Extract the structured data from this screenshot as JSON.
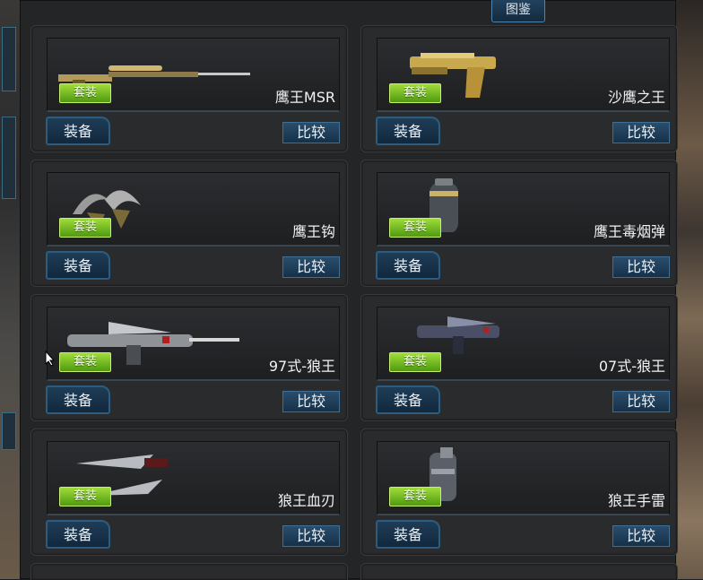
{
  "top_tab": "图鉴",
  "suit_label": "套装",
  "equip_label": "装备",
  "compare_label": "比较",
  "colors": {
    "accent_green": "#6fbf1e",
    "button_blue": "#1a3850",
    "panel": "#242526"
  },
  "items": [
    {
      "name": "鹰王MSR",
      "icon": "sniper-rifle-icon"
    },
    {
      "name": "沙鹰之王",
      "icon": "pistol-icon"
    },
    {
      "name": "鹰王钩",
      "icon": "claw-hook-icon"
    },
    {
      "name": "鹰王毒烟弹",
      "icon": "smoke-grenade-icon"
    },
    {
      "name": "97式-狼王",
      "icon": "assault-rifle-icon"
    },
    {
      "name": "07式-狼王",
      "icon": "smg-icon"
    },
    {
      "name": "狼王血刃",
      "icon": "blade-icon"
    },
    {
      "name": "狼王手雷",
      "icon": "grenade-icon"
    }
  ]
}
